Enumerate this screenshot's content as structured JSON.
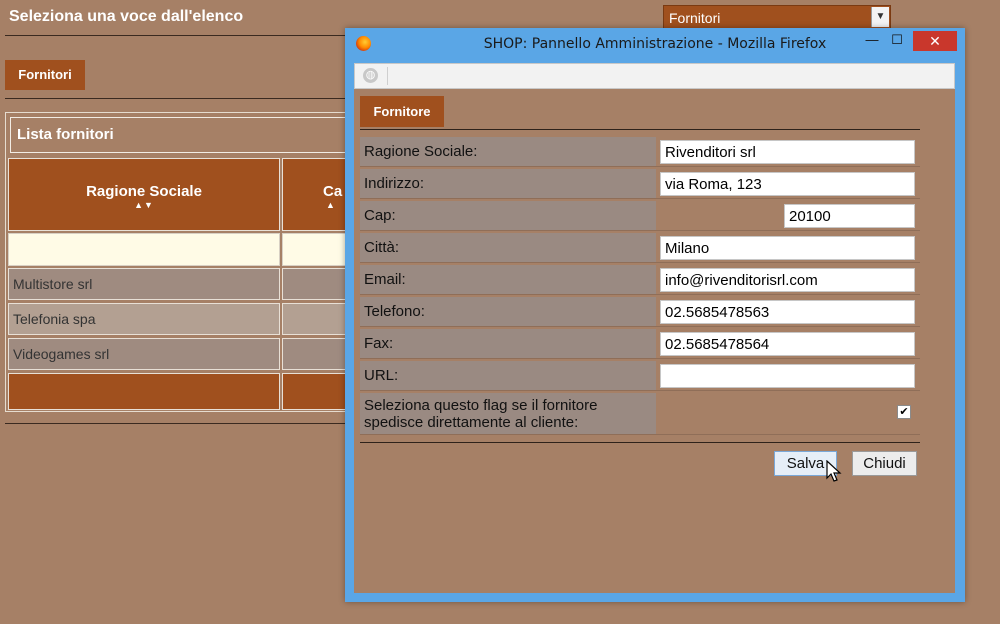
{
  "background": {
    "page_title": "Seleziona una voce dall'elenco",
    "select": {
      "value": "Fornitori",
      "arrow": "▼"
    },
    "tab_label": "Fornitori",
    "list": {
      "header": "Lista fornitori",
      "columns": [
        {
          "label": "Ragione Sociale",
          "sort": "▲▼"
        },
        {
          "label": "Ca",
          "sort": "▲"
        }
      ],
      "rows": [
        "Multistore srl",
        "Telefonia spa",
        "Videogames srl"
      ]
    }
  },
  "window": {
    "title": "SHOP: Pannello Amministrazione - Mozilla Firefox",
    "buttons": {
      "minimize": "—",
      "maximize": "☐",
      "close": "✕"
    },
    "urlbar_value": "",
    "icons": {
      "app": "firefox-icon",
      "site": "globe-icon"
    }
  },
  "form": {
    "tab_label": "Fornitore",
    "fields": [
      {
        "label": "Ragione Sociale:",
        "value": "Rivenditori srl"
      },
      {
        "label": "Indirizzo:",
        "value": "via Roma, 123"
      },
      {
        "label": "Cap:",
        "value": "20100"
      },
      {
        "label": "Città:",
        "value": "Milano"
      },
      {
        "label": "Email:",
        "value": "info@rivenditorisrl.com"
      },
      {
        "label": "Telefono:",
        "value": "02.5685478563"
      },
      {
        "label": "Fax:",
        "value": "02.5685478564"
      },
      {
        "label": "URL:",
        "value": ""
      }
    ],
    "flag": {
      "label": "Seleziona questo flag se il fornitore spedisce direttamente al cliente:",
      "checked": true,
      "mark": "✔"
    },
    "save_label": "Salva",
    "close_label": "Chiudi"
  },
  "colors": {
    "page_bg": "#a68066",
    "accent": "#a0501e",
    "window_frame": "#5aa6e6",
    "close_button": "#c9372c"
  }
}
